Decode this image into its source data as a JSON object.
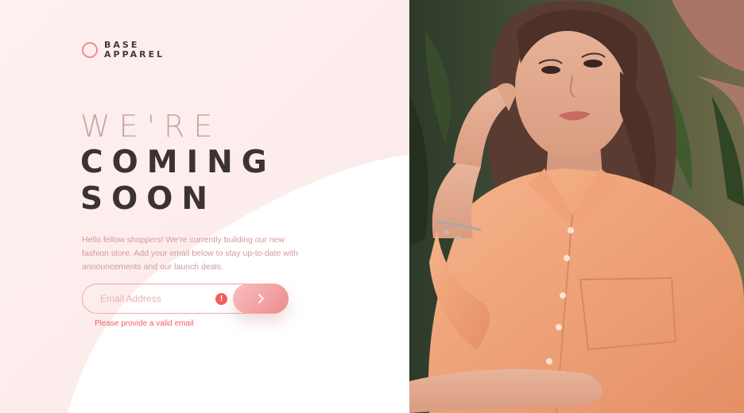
{
  "brand": {
    "line1": "BASE",
    "line2": "APPAREL"
  },
  "hero": {
    "line_light": "WE'RE",
    "line_bold_1": "COMING",
    "line_bold_2": "SOON"
  },
  "description": "Hello fellow shoppers! We're currently building our new fashion store. Add your email below to stay up-to-date with announcements and our launch deals.",
  "form": {
    "email_placeholder": "Email Address",
    "email_value": "",
    "error_icon_glyph": "!",
    "error_message": "Please provide a valid email",
    "submit_icon": "chevron-right-icon"
  },
  "colors": {
    "accent": "#ef8e8e",
    "error": "#f25f5c",
    "heading_dark": "#3b3232",
    "heading_light": "#c9a4a4",
    "text_pink": "#d29a9a"
  }
}
